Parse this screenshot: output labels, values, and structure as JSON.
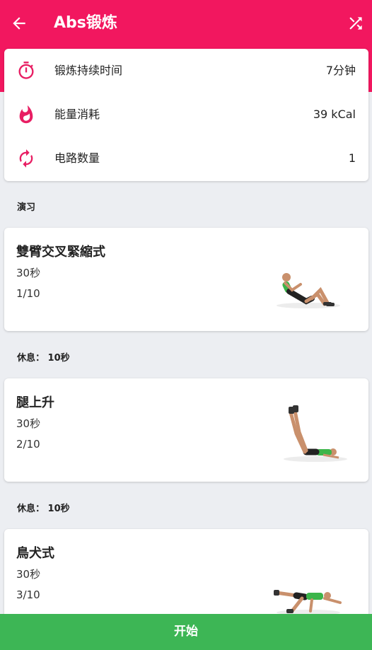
{
  "header": {
    "title": "Abs锻炼",
    "back_icon": "arrow-left-icon",
    "shuffle_icon": "shuffle-icon",
    "color": "#f2175f"
  },
  "summary": {
    "duration": {
      "label": "锻炼持续时间",
      "value": "7分钟",
      "icon": "stopwatch-icon"
    },
    "energy": {
      "label": "能量消耗",
      "value": "39 kCal",
      "icon": "flame-icon"
    },
    "circuits": {
      "label": "电路数量",
      "value": "1",
      "icon": "repeat-icon"
    }
  },
  "section_title": "演习",
  "exercises": [
    {
      "name": "雙臂交叉緊縮式",
      "duration": "30秒",
      "index": "1/10"
    },
    {
      "name": "腿上升",
      "duration": "30秒",
      "index": "2/10"
    },
    {
      "name": "鳥犬式",
      "duration": "30秒",
      "index": "3/10"
    }
  ],
  "rests": [
    "休息： 10秒",
    "休息： 10秒"
  ],
  "start_button": {
    "label": "开始",
    "color": "#3db655"
  }
}
